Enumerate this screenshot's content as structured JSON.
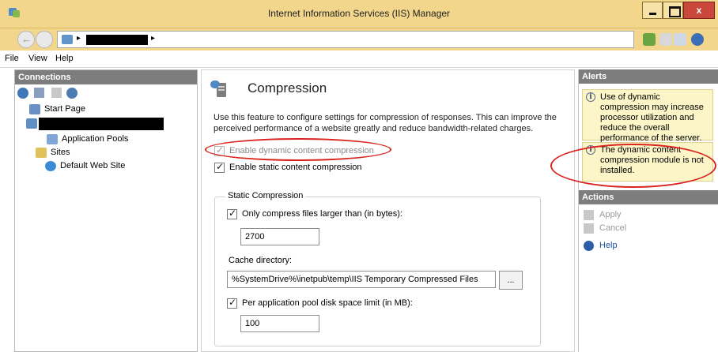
{
  "window": {
    "title": "Internet Information Services (IIS) Manager",
    "close_glyph": "x"
  },
  "address": {
    "separator": "▸"
  },
  "menu": {
    "items": [
      "File",
      "View",
      "Help"
    ]
  },
  "connections": {
    "header": "Connections",
    "tree": {
      "start_page": "Start Page",
      "application_pools": "Application Pools",
      "sites": "Sites",
      "default_web_site": "Default Web Site"
    }
  },
  "main": {
    "title": "Compression",
    "description": "Use this feature to configure settings for compression of responses. This can improve the perceived performance of a website greatly and reduce bandwidth-related charges.",
    "dynamic_checkbox_label": "Enable dynamic content compression",
    "dynamic_checked": true,
    "dynamic_enabled": false,
    "static_checkbox_label": "Enable static content compression",
    "static_checked": true,
    "group_title": "Static Compression",
    "only_larger_label": "Only compress files larger than (in bytes):",
    "only_larger_value": "2700",
    "cache_dir_label": "Cache directory:",
    "cache_dir_value": "%SystemDrive%\\inetpub\\temp\\IIS Temporary Compressed Files",
    "browse_label": "...",
    "pool_limit_label": "Per application pool disk space limit (in MB):",
    "pool_limit_value": "100"
  },
  "alerts": {
    "header": "Alerts",
    "items": [
      "Use of dynamic compression may increase processor utilization and reduce the overall performance of the server.",
      "The dynamic content compression module is not installed."
    ]
  },
  "actions": {
    "header": "Actions",
    "apply": "Apply",
    "cancel": "Cancel",
    "help": "Help"
  },
  "colors": {
    "title_bar": "#f2d68b",
    "panel_header": "#7d7d7d",
    "alert_bg": "#fbf5c7",
    "annotation_red": "#d9241e"
  }
}
